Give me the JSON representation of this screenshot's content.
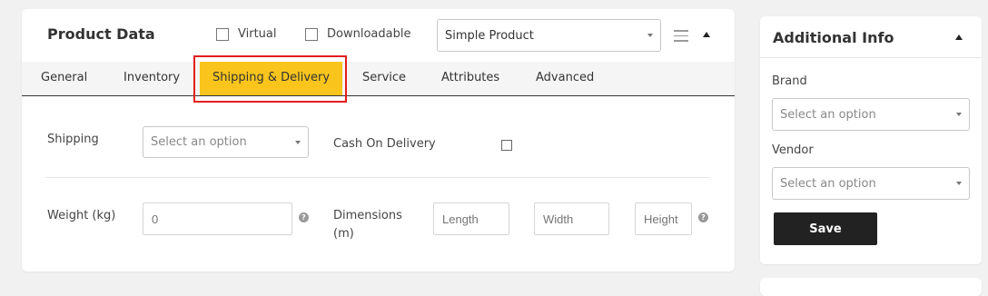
{
  "product_data": {
    "title": "Product Data",
    "virtual_label": "Virtual",
    "downloadable_label": "Downloadable",
    "product_type": "Simple Product",
    "tabs": [
      {
        "label": "General"
      },
      {
        "label": "Inventory"
      },
      {
        "label": "Shipping & Delivery",
        "active": true
      },
      {
        "label": "Service"
      },
      {
        "label": "Attributes"
      },
      {
        "label": "Advanced"
      }
    ],
    "shipping": {
      "shipping_label": "Shipping",
      "shipping_placeholder": "Select an option",
      "cod_label": "Cash On Delivery",
      "weight_label": "Weight (kg)",
      "weight_placeholder": "0",
      "dimensions_label_line1": "Dimensions",
      "dimensions_label_line2": "(m)",
      "length_placeholder": "Length",
      "width_placeholder": "Width",
      "height_placeholder": "Height"
    }
  },
  "additional_info": {
    "title": "Additional Info",
    "brand_label": "Brand",
    "brand_placeholder": "Select an option",
    "vendor_label": "Vendor",
    "vendor_placeholder": "Select an option",
    "save_label": "Save"
  },
  "colors": {
    "active_tab": "#f9c51c",
    "highlight_border": "#e31d1d",
    "save_button": "#222222"
  },
  "icons": [
    "checkbox-icon",
    "dropdown-caret-icon",
    "hamburger-icon",
    "collapse-caret-icon",
    "help-icon"
  ]
}
